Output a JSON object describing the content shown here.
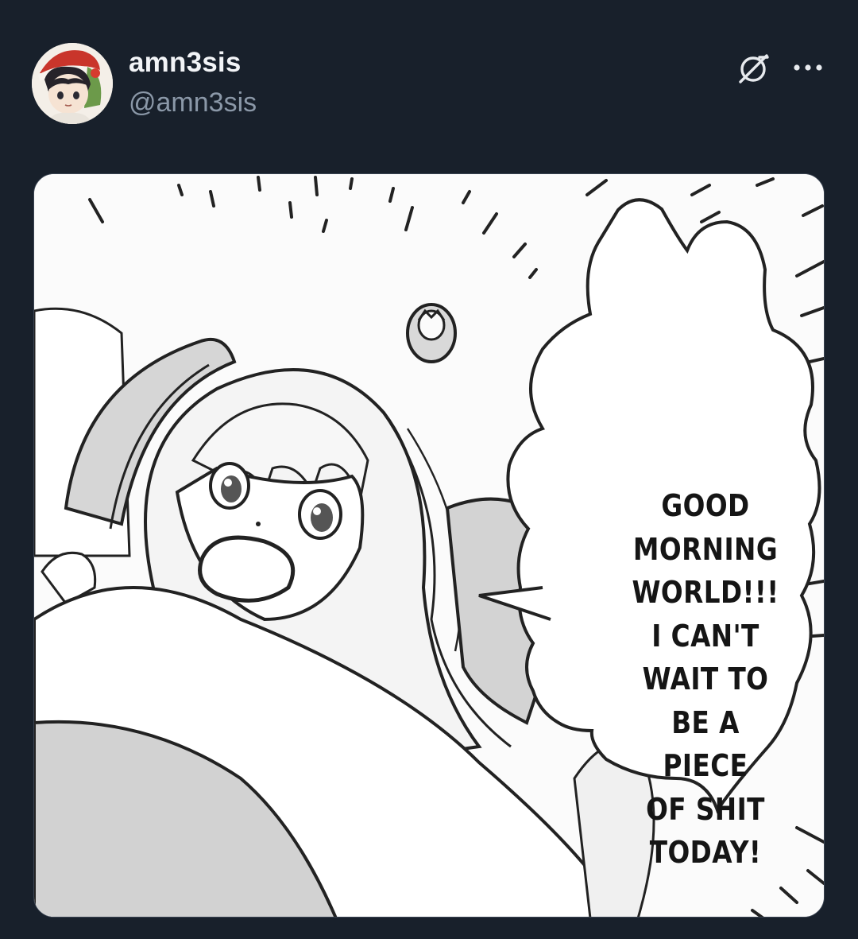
{
  "post": {
    "author": {
      "display_name": "amn3sis",
      "handle": "@amn3sis",
      "avatar_icon": "avatar-icon"
    },
    "actions": {
      "mute_icon": "mute-icon",
      "more_icon": "more-options-icon"
    },
    "media": {
      "type": "manga-panel-image",
      "speech_bubble_lines": [
        "GOOD",
        "MORNING",
        "WORLD!!!",
        "I CAN'T",
        "WAIT TO",
        "BE A",
        "PIECE",
        "OF SHIT",
        "TODAY!"
      ]
    }
  },
  "colors": {
    "background": "#18202b",
    "name_text": "#f2f4f7",
    "handle_text": "#8b98a8",
    "icon": "#e7eaee"
  }
}
